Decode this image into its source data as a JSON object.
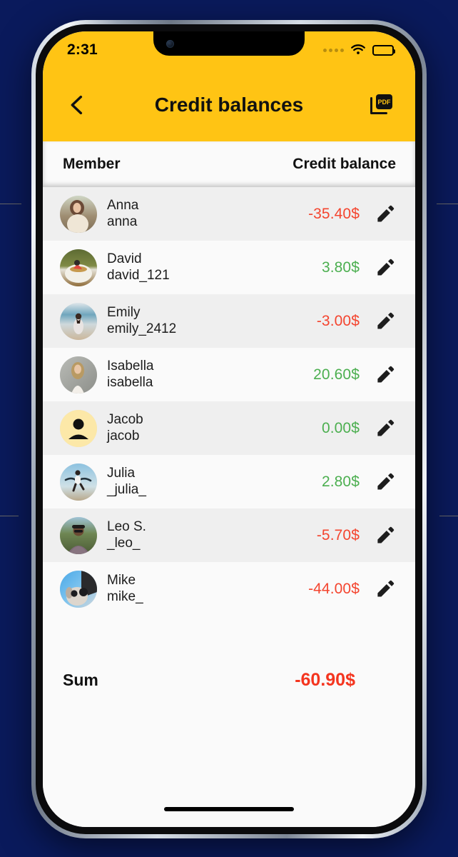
{
  "statusbar": {
    "time": "2:31",
    "signal_icon": "signal-dots-icon",
    "wifi_icon": "wifi-icon",
    "battery_icon": "battery-full-icon"
  },
  "navbar": {
    "back_icon": "chevron-left-icon",
    "title": "Credit balances",
    "export_icon": "pdf-icon",
    "export_label": "PDF"
  },
  "table": {
    "col_member": "Member",
    "col_balance": "Credit balance",
    "edit_icon": "pencil-icon",
    "rows": [
      {
        "name": "Anna",
        "username": "anna",
        "balance": "-35.40$",
        "sign": "neg",
        "avatar": "photo-woman-field"
      },
      {
        "name": "David",
        "username": "david_121",
        "balance": "3.80$",
        "sign": "pos",
        "avatar": "photo-man-boat"
      },
      {
        "name": "Emily",
        "username": "emily_2412",
        "balance": "-3.00$",
        "sign": "neg",
        "avatar": "photo-woman-beach"
      },
      {
        "name": "Isabella",
        "username": "isabella",
        "balance": "20.60$",
        "sign": "pos",
        "avatar": "photo-woman-wall"
      },
      {
        "name": "Jacob",
        "username": "jacob",
        "balance": "0.00$",
        "sign": "pos",
        "avatar": "placeholder-person"
      },
      {
        "name": "Julia",
        "username": "_julia_",
        "balance": "2.80$",
        "sign": "pos",
        "avatar": "photo-woman-jump"
      },
      {
        "name": "Leo S.",
        "username": "_leo_",
        "balance": "-5.70$",
        "sign": "neg",
        "avatar": "photo-man-hat"
      },
      {
        "name": "Mike",
        "username": "mike_",
        "balance": "-44.00$",
        "sign": "neg",
        "avatar": "photo-man-dog"
      }
    ]
  },
  "summary": {
    "label": "Sum",
    "value": "-60.90$"
  },
  "colors": {
    "accent_yellow": "#FFC414",
    "negative": "#F4452F",
    "positive": "#4CAF50",
    "sum_negative": "#F4351F",
    "row_alt": "#EFEFEF",
    "row_base": "#FAFAFA",
    "backdrop": "#0a1a5c"
  }
}
